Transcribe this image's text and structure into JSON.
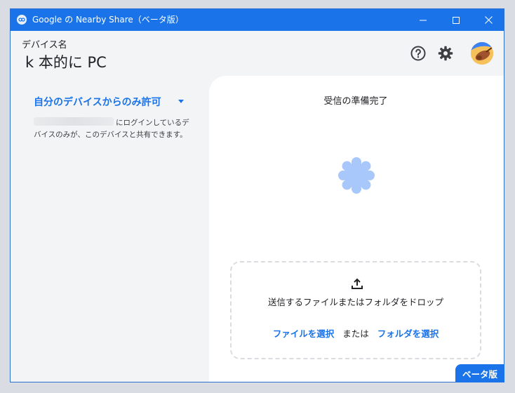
{
  "window": {
    "title": "Google の Nearby Share（ベータ版）",
    "controls": {
      "minimize_icon": "minimize-icon",
      "maximize_icon": "maximize-icon",
      "close_icon": "close-icon"
    }
  },
  "header": {
    "device_label": "デバイス名",
    "device_name": "k 本的に PC",
    "help_icon": "help-circle-icon",
    "settings_icon": "gear-icon"
  },
  "visibility": {
    "selected": "自分のデバイスからのみ許可",
    "description": "にログインしているデバイスのみが、このデバイスと共有できます。"
  },
  "receive": {
    "status": "受信の準備完了"
  },
  "dropzone": {
    "instruction": "送信するファイルまたはフォルダをドロップ",
    "select_file": "ファイルを選択",
    "or": "または",
    "select_folder": "フォルダを選択"
  },
  "badge": {
    "label": "ベータ版"
  },
  "colors": {
    "accent": "#1a73e8",
    "spinner": "#a8c7fa"
  }
}
